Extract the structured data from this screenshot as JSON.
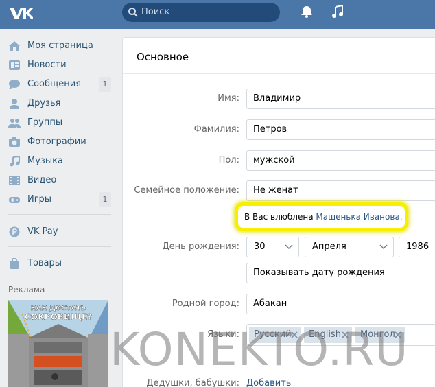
{
  "topbar": {
    "search_placeholder": "Поиск"
  },
  "sidebar": {
    "items": [
      {
        "label": "Моя страница",
        "icon": "home-icon"
      },
      {
        "label": "Новости",
        "icon": "news-icon"
      },
      {
        "label": "Сообщения",
        "icon": "messages-icon",
        "count": "1"
      },
      {
        "label": "Друзья",
        "icon": "friend-icon"
      },
      {
        "label": "Группы",
        "icon": "groups-icon"
      },
      {
        "label": "Фотографии",
        "icon": "camera-icon"
      },
      {
        "label": "Музыка",
        "icon": "music-icon"
      },
      {
        "label": "Видео",
        "icon": "video-icon"
      },
      {
        "label": "Игры",
        "icon": "gamepad-icon",
        "count": "1"
      }
    ],
    "vkpay": "VK Pay",
    "goods": "Товары",
    "ad_label": "Реклама",
    "ad_text_1": "КАК ДОСТАТЬ",
    "ad_text_2": "СОКРОВИЩЕ?"
  },
  "main": {
    "section_title": "Основное",
    "fields": {
      "first_name_label": "Имя:",
      "first_name": "Владимир",
      "last_name_label": "Фамилия:",
      "last_name": "Петров",
      "sex_label": "Пол:",
      "sex": "мужской",
      "marital_label": "Семейное положение:",
      "marital": "Не женат",
      "in_love_text": "В Вас влюблена",
      "in_love_name": "Машенька Иванова.",
      "birthday_label": "День рождения:",
      "birth_day": "30",
      "birth_month": "Апреля",
      "birth_year": "1986",
      "birthday_visibility": "Показывать дату рождения",
      "hometown_label": "Родной город:",
      "hometown": "Абакан",
      "languages_label": "Языки:",
      "languages": [
        "Русский",
        "English",
        "Монгол"
      ],
      "grandparents_label": "Дедушки, бабушки:",
      "add_link": "Добавить"
    }
  },
  "watermark": "KONEKTO.RU",
  "colors": {
    "header": "#4a76a8",
    "link": "#2a5885",
    "highlight": "#f6f000"
  }
}
